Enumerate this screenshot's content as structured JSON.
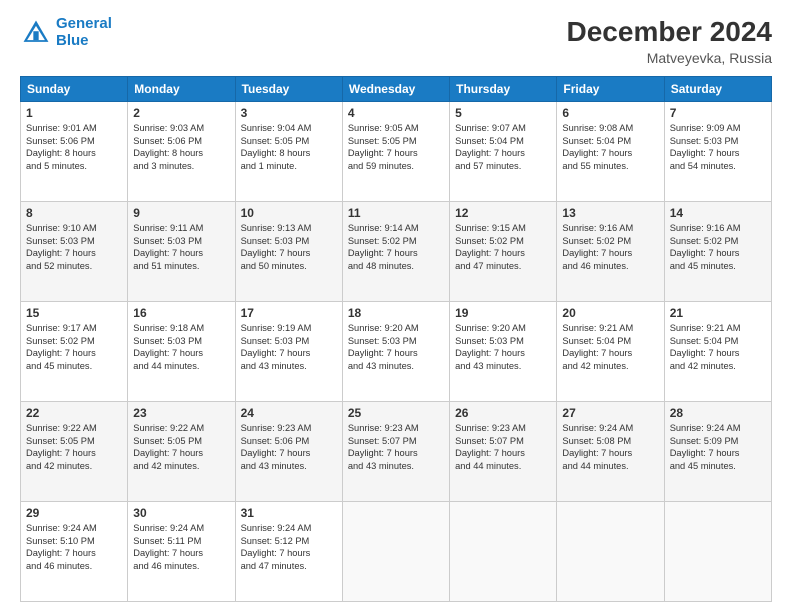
{
  "logo": {
    "line1": "General",
    "line2": "Blue"
  },
  "title": "December 2024",
  "subtitle": "Matveyevka, Russia",
  "days_header": [
    "Sunday",
    "Monday",
    "Tuesday",
    "Wednesday",
    "Thursday",
    "Friday",
    "Saturday"
  ],
  "weeks": [
    [
      {
        "day": "1",
        "lines": [
          "Sunrise: 9:01 AM",
          "Sunset: 5:06 PM",
          "Daylight: 8 hours",
          "and 5 minutes."
        ]
      },
      {
        "day": "2",
        "lines": [
          "Sunrise: 9:03 AM",
          "Sunset: 5:06 PM",
          "Daylight: 8 hours",
          "and 3 minutes."
        ]
      },
      {
        "day": "3",
        "lines": [
          "Sunrise: 9:04 AM",
          "Sunset: 5:05 PM",
          "Daylight: 8 hours",
          "and 1 minute."
        ]
      },
      {
        "day": "4",
        "lines": [
          "Sunrise: 9:05 AM",
          "Sunset: 5:05 PM",
          "Daylight: 7 hours",
          "and 59 minutes."
        ]
      },
      {
        "day": "5",
        "lines": [
          "Sunrise: 9:07 AM",
          "Sunset: 5:04 PM",
          "Daylight: 7 hours",
          "and 57 minutes."
        ]
      },
      {
        "day": "6",
        "lines": [
          "Sunrise: 9:08 AM",
          "Sunset: 5:04 PM",
          "Daylight: 7 hours",
          "and 55 minutes."
        ]
      },
      {
        "day": "7",
        "lines": [
          "Sunrise: 9:09 AM",
          "Sunset: 5:03 PM",
          "Daylight: 7 hours",
          "and 54 minutes."
        ]
      }
    ],
    [
      {
        "day": "8",
        "lines": [
          "Sunrise: 9:10 AM",
          "Sunset: 5:03 PM",
          "Daylight: 7 hours",
          "and 52 minutes."
        ]
      },
      {
        "day": "9",
        "lines": [
          "Sunrise: 9:11 AM",
          "Sunset: 5:03 PM",
          "Daylight: 7 hours",
          "and 51 minutes."
        ]
      },
      {
        "day": "10",
        "lines": [
          "Sunrise: 9:13 AM",
          "Sunset: 5:03 PM",
          "Daylight: 7 hours",
          "and 50 minutes."
        ]
      },
      {
        "day": "11",
        "lines": [
          "Sunrise: 9:14 AM",
          "Sunset: 5:02 PM",
          "Daylight: 7 hours",
          "and 48 minutes."
        ]
      },
      {
        "day": "12",
        "lines": [
          "Sunrise: 9:15 AM",
          "Sunset: 5:02 PM",
          "Daylight: 7 hours",
          "and 47 minutes."
        ]
      },
      {
        "day": "13",
        "lines": [
          "Sunrise: 9:16 AM",
          "Sunset: 5:02 PM",
          "Daylight: 7 hours",
          "and 46 minutes."
        ]
      },
      {
        "day": "14",
        "lines": [
          "Sunrise: 9:16 AM",
          "Sunset: 5:02 PM",
          "Daylight: 7 hours",
          "and 45 minutes."
        ]
      }
    ],
    [
      {
        "day": "15",
        "lines": [
          "Sunrise: 9:17 AM",
          "Sunset: 5:02 PM",
          "Daylight: 7 hours",
          "and 45 minutes."
        ]
      },
      {
        "day": "16",
        "lines": [
          "Sunrise: 9:18 AM",
          "Sunset: 5:03 PM",
          "Daylight: 7 hours",
          "and 44 minutes."
        ]
      },
      {
        "day": "17",
        "lines": [
          "Sunrise: 9:19 AM",
          "Sunset: 5:03 PM",
          "Daylight: 7 hours",
          "and 43 minutes."
        ]
      },
      {
        "day": "18",
        "lines": [
          "Sunrise: 9:20 AM",
          "Sunset: 5:03 PM",
          "Daylight: 7 hours",
          "and 43 minutes."
        ]
      },
      {
        "day": "19",
        "lines": [
          "Sunrise: 9:20 AM",
          "Sunset: 5:03 PM",
          "Daylight: 7 hours",
          "and 43 minutes."
        ]
      },
      {
        "day": "20",
        "lines": [
          "Sunrise: 9:21 AM",
          "Sunset: 5:04 PM",
          "Daylight: 7 hours",
          "and 42 minutes."
        ]
      },
      {
        "day": "21",
        "lines": [
          "Sunrise: 9:21 AM",
          "Sunset: 5:04 PM",
          "Daylight: 7 hours",
          "and 42 minutes."
        ]
      }
    ],
    [
      {
        "day": "22",
        "lines": [
          "Sunrise: 9:22 AM",
          "Sunset: 5:05 PM",
          "Daylight: 7 hours",
          "and 42 minutes."
        ]
      },
      {
        "day": "23",
        "lines": [
          "Sunrise: 9:22 AM",
          "Sunset: 5:05 PM",
          "Daylight: 7 hours",
          "and 42 minutes."
        ]
      },
      {
        "day": "24",
        "lines": [
          "Sunrise: 9:23 AM",
          "Sunset: 5:06 PM",
          "Daylight: 7 hours",
          "and 43 minutes."
        ]
      },
      {
        "day": "25",
        "lines": [
          "Sunrise: 9:23 AM",
          "Sunset: 5:07 PM",
          "Daylight: 7 hours",
          "and 43 minutes."
        ]
      },
      {
        "day": "26",
        "lines": [
          "Sunrise: 9:23 AM",
          "Sunset: 5:07 PM",
          "Daylight: 7 hours",
          "and 44 minutes."
        ]
      },
      {
        "day": "27",
        "lines": [
          "Sunrise: 9:24 AM",
          "Sunset: 5:08 PM",
          "Daylight: 7 hours",
          "and 44 minutes."
        ]
      },
      {
        "day": "28",
        "lines": [
          "Sunrise: 9:24 AM",
          "Sunset: 5:09 PM",
          "Daylight: 7 hours",
          "and 45 minutes."
        ]
      }
    ],
    [
      {
        "day": "29",
        "lines": [
          "Sunrise: 9:24 AM",
          "Sunset: 5:10 PM",
          "Daylight: 7 hours",
          "and 46 minutes."
        ]
      },
      {
        "day": "30",
        "lines": [
          "Sunrise: 9:24 AM",
          "Sunset: 5:11 PM",
          "Daylight: 7 hours",
          "and 46 minutes."
        ]
      },
      {
        "day": "31",
        "lines": [
          "Sunrise: 9:24 AM",
          "Sunset: 5:12 PM",
          "Daylight: 7 hours",
          "and 47 minutes."
        ]
      },
      null,
      null,
      null,
      null
    ]
  ]
}
